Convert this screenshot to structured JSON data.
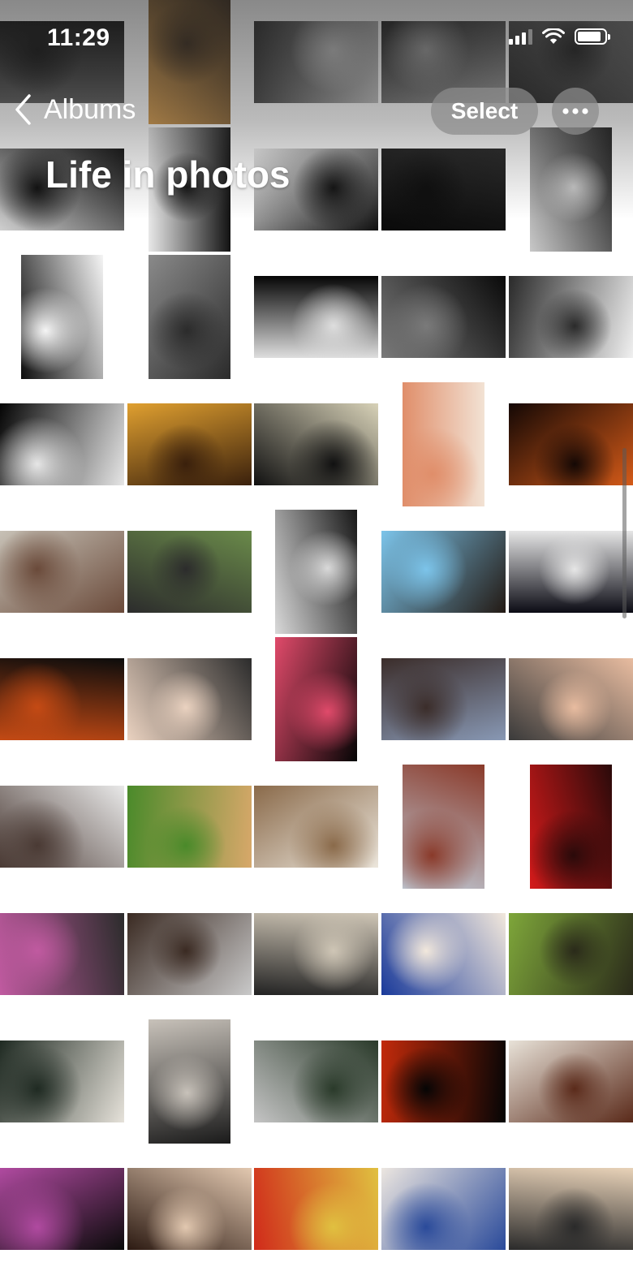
{
  "status_bar": {
    "time": "11:29",
    "icons": [
      "cellular-signal-icon",
      "wifi-icon",
      "battery-icon"
    ]
  },
  "nav": {
    "back_icon": "chevron-left-icon",
    "back_label": "Albums",
    "select_label": "Select",
    "more_icon": "ellipsis-icon"
  },
  "album": {
    "title": "Life in photos"
  },
  "grid": {
    "rows": [
      [
        {
          "shape": "landscape",
          "colors": [
            "#5a5a5a",
            "#111111"
          ]
        },
        {
          "shape": "portrait",
          "colors": [
            "#d59a4a",
            "#3a2a1a"
          ]
        },
        {
          "shape": "landscape",
          "colors": [
            "#2a2a2a",
            "#bdbdbd"
          ]
        },
        {
          "shape": "landscape",
          "colors": [
            "#1f1f1f",
            "#9a9a9a"
          ]
        },
        {
          "shape": "landscape",
          "colors": [
            "#6b6b6b",
            "#1e1e1e"
          ]
        }
      ],
      [
        {
          "shape": "landscape",
          "colors": [
            "#cfcfcf",
            "#0d0d0d"
          ]
        },
        {
          "shape": "portrait",
          "colors": [
            "#e8e8e8",
            "#121212"
          ]
        },
        {
          "shape": "landscape",
          "colors": [
            "#f2f2f2",
            "#101010"
          ]
        },
        {
          "shape": "landscape",
          "colors": [
            "#222222",
            "#0a0a0a"
          ]
        },
        {
          "shape": "portrait",
          "colors": [
            "#1a1a1a",
            "#c8c8c8"
          ]
        }
      ],
      [
        {
          "shape": "portrait",
          "colors": [
            "#0d0d0d",
            "#f5f5f5"
          ]
        },
        {
          "shape": "portrait",
          "colors": [
            "#8a8a8a",
            "#2b2b2b"
          ]
        },
        {
          "shape": "landscape",
          "colors": [
            "#050505",
            "#dedede"
          ]
        },
        {
          "shape": "landscape",
          "colors": [
            "#0a0a0a",
            "#7a7a7a"
          ]
        },
        {
          "shape": "landscape",
          "colors": [
            "#f0f0f0",
            "#2a2a2a"
          ]
        }
      ],
      [
        {
          "shape": "landscape",
          "colors": [
            "#050505",
            "#e6e6e6"
          ]
        },
        {
          "shape": "landscape",
          "colors": [
            "#e0a030",
            "#3a200c"
          ]
        },
        {
          "shape": "landscape",
          "colors": [
            "#d8d2b8",
            "#111111"
          ]
        },
        {
          "shape": "portrait",
          "colors": [
            "#f2e2d4",
            "#e08e6a"
          ]
        },
        {
          "shape": "landscape",
          "colors": [
            "#d45a18",
            "#140805"
          ]
        }
      ],
      [
        {
          "shape": "landscape",
          "colors": [
            "#c7c1b6",
            "#6a4a3a"
          ]
        },
        {
          "shape": "landscape",
          "colors": [
            "#6a8a4a",
            "#2c2c2c"
          ]
        },
        {
          "shape": "portrait",
          "colors": [
            "#171717",
            "#d9d9d9"
          ]
        },
        {
          "shape": "landscape",
          "colors": [
            "#231a14",
            "#7cc4ea"
          ]
        },
        {
          "shape": "landscape",
          "colors": [
            "#0b0b14",
            "#e6e6e6"
          ]
        }
      ],
      [
        {
          "shape": "landscape",
          "colors": [
            "#0c0c0c",
            "#c44a14"
          ]
        },
        {
          "shape": "landscape",
          "colors": [
            "#2c2c2c",
            "#ead2c0"
          ]
        },
        {
          "shape": "portrait",
          "colors": [
            "#050505",
            "#e04a6a"
          ]
        },
        {
          "shape": "landscape",
          "colors": [
            "#8898b4",
            "#3b2d2a"
          ]
        },
        {
          "shape": "landscape",
          "colors": [
            "#3a3a3a",
            "#e8bca0"
          ]
        }
      ],
      [
        {
          "shape": "landscape",
          "colors": [
            "#e9e9e9",
            "#4a3a34"
          ]
        },
        {
          "shape": "landscape",
          "colors": [
            "#d8a86a",
            "#4a8a2a"
          ]
        },
        {
          "shape": "landscape",
          "colors": [
            "#ece6dc",
            "#8a6a4a"
          ]
        },
        {
          "shape": "portrait",
          "colors": [
            "#c0ccd8",
            "#8a3a2a"
          ]
        },
        {
          "shape": "portrait",
          "colors": [
            "#d41a1a",
            "#2a0a0a"
          ]
        }
      ],
      [
        {
          "shape": "landscape",
          "colors": [
            "#2c2c2c",
            "#c05aa0"
          ]
        },
        {
          "shape": "landscape",
          "colors": [
            "#c9c9c9",
            "#3a2a22"
          ]
        },
        {
          "shape": "landscape",
          "colors": [
            "#222222",
            "#cfc6b6"
          ]
        },
        {
          "shape": "landscape",
          "colors": [
            "#1a3a9a",
            "#f2e8dc"
          ]
        },
        {
          "shape": "landscape",
          "colors": [
            "#7ea63a",
            "#2a2a1a"
          ]
        }
      ],
      [
        {
          "shape": "landscape",
          "colors": [
            "#e6e2da",
            "#1f2a22"
          ]
        },
        {
          "shape": "portrait",
          "colors": [
            "#1a1a1a",
            "#c8c2ba"
          ]
        },
        {
          "shape": "landscape",
          "colors": [
            "#c4c4c4",
            "#2a3a2a"
          ]
        },
        {
          "shape": "landscape",
          "colors": [
            "#c22a0a",
            "#050505"
          ]
        },
        {
          "shape": "landscape",
          "colors": [
            "#e8e2d8",
            "#5a2a1a"
          ]
        }
      ],
      [
        {
          "shape": "landscape",
          "colors": [
            "#0a0a0a",
            "#b04aa0"
          ]
        },
        {
          "shape": "landscape",
          "colors": [
            "#2c1a12",
            "#e2c8b0"
          ]
        },
        {
          "shape": "landscape",
          "colors": [
            "#d02a1a",
            "#e0c040"
          ]
        },
        {
          "shape": "landscape",
          "colors": [
            "#ece6e0",
            "#2a4a9a"
          ]
        },
        {
          "shape": "landscape",
          "colors": [
            "#e8d2b8",
            "#2a2a2a"
          ]
        }
      ]
    ]
  }
}
